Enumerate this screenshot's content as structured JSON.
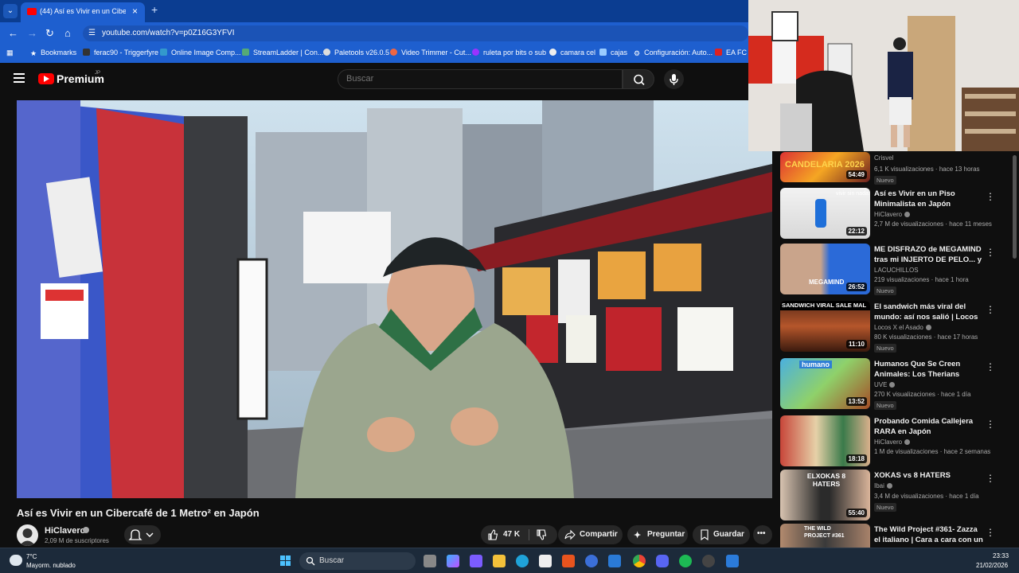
{
  "browser": {
    "tab_title": "(44) Así es Vivir en un Cibercafé",
    "url": "youtube.com/watch?v=p0Z16G3YFVI",
    "bookmarks": [
      "Bookmarks",
      "ferac90 - Triggerfyre",
      "Online Image Comp...",
      "StreamLadder | Con...",
      "Paletools v26.0.5",
      "Video Trimmer - Cut...",
      "ruleta por bits o sub",
      "camara cel",
      "cajas",
      "Configuración: Auto...",
      "EA FC 2"
    ]
  },
  "youtube": {
    "logo_text": "Premium",
    "region": "JP",
    "search_placeholder": "Buscar"
  },
  "video": {
    "title": "Así es Vivir en un Cibercafé de 1 Metro² en Japón",
    "channel": "HiClavero",
    "subscribers": "2,09 M de suscriptores",
    "likes": "47 K",
    "share": "Compartir",
    "ask": "Preguntar",
    "save": "Guardar",
    "overlay_text": "歌舞伎町西町会"
  },
  "recommendations": [
    {
      "title": "",
      "channel": "Crisvel",
      "meta": "6,1 K visualizaciones · hace 13 horas",
      "duration": "54:49",
      "badge": "Nuevo",
      "thumb_label": "CANDELARIA 2026"
    },
    {
      "title": "Así es Vivir en un Piso Minimalista en Japón",
      "channel": "HiClavero",
      "meta": "2,7 M de visualizaciones · hace 11 meses",
      "duration": "22:12",
      "badge": "",
      "thumb_label": "vivir sin nada."
    },
    {
      "title": "ME DISFRAZO de MEGAMIND tras mi INJERTO DE PELO... y ...",
      "channel": "LACUCHILLOS",
      "meta": "219 visualizaciones · hace 1 hora",
      "duration": "26:52",
      "badge": "Nuevo",
      "thumb_label": "MEGAMIND"
    },
    {
      "title": "El sandwich más viral del mundo: así nos salió | Locos X...",
      "channel": "Locos X el Asado",
      "meta": "80 K visualizaciones · hace 17 horas",
      "duration": "11:10",
      "badge": "Nuevo",
      "thumb_label": "SANDWICH VIRAL SALE MAL"
    },
    {
      "title": "Humanos Que Se Creen Animales: Los Therians",
      "channel": "UVE",
      "meta": "270 K visualizaciones · hace 1 día",
      "duration": "13:52",
      "badge": "Nuevo",
      "thumb_label": "humano"
    },
    {
      "title": "Probando Comida Callejera RARA en Japón",
      "channel": "HiClavero",
      "meta": "1 M de visualizaciones · hace 2 semanas",
      "duration": "18:18",
      "badge": "",
      "thumb_label": ""
    },
    {
      "title": "XOKAS vs 8 HATERS",
      "channel": "Ibai",
      "meta": "3,4 M de visualizaciones · hace 1 día",
      "duration": "55:40",
      "badge": "Nuevo",
      "thumb_label": "ELXOKAS 8 HATERS"
    },
    {
      "title": "The Wild Project #361- Zazza el italiano | Cara a cara con un ...",
      "channel": "",
      "meta": "",
      "duration": "",
      "badge": "",
      "thumb_label": "THE WILD PROJECT #361"
    }
  ],
  "taskbar": {
    "temperature": "7°C",
    "weather": "Mayorm. nublado",
    "search": "Buscar",
    "time": "23:33",
    "date": "21/02/2026"
  },
  "colors": {
    "browser_blue": "#1e5fcf",
    "youtube_red": "#ff0000",
    "background": "#0f0f0f"
  }
}
